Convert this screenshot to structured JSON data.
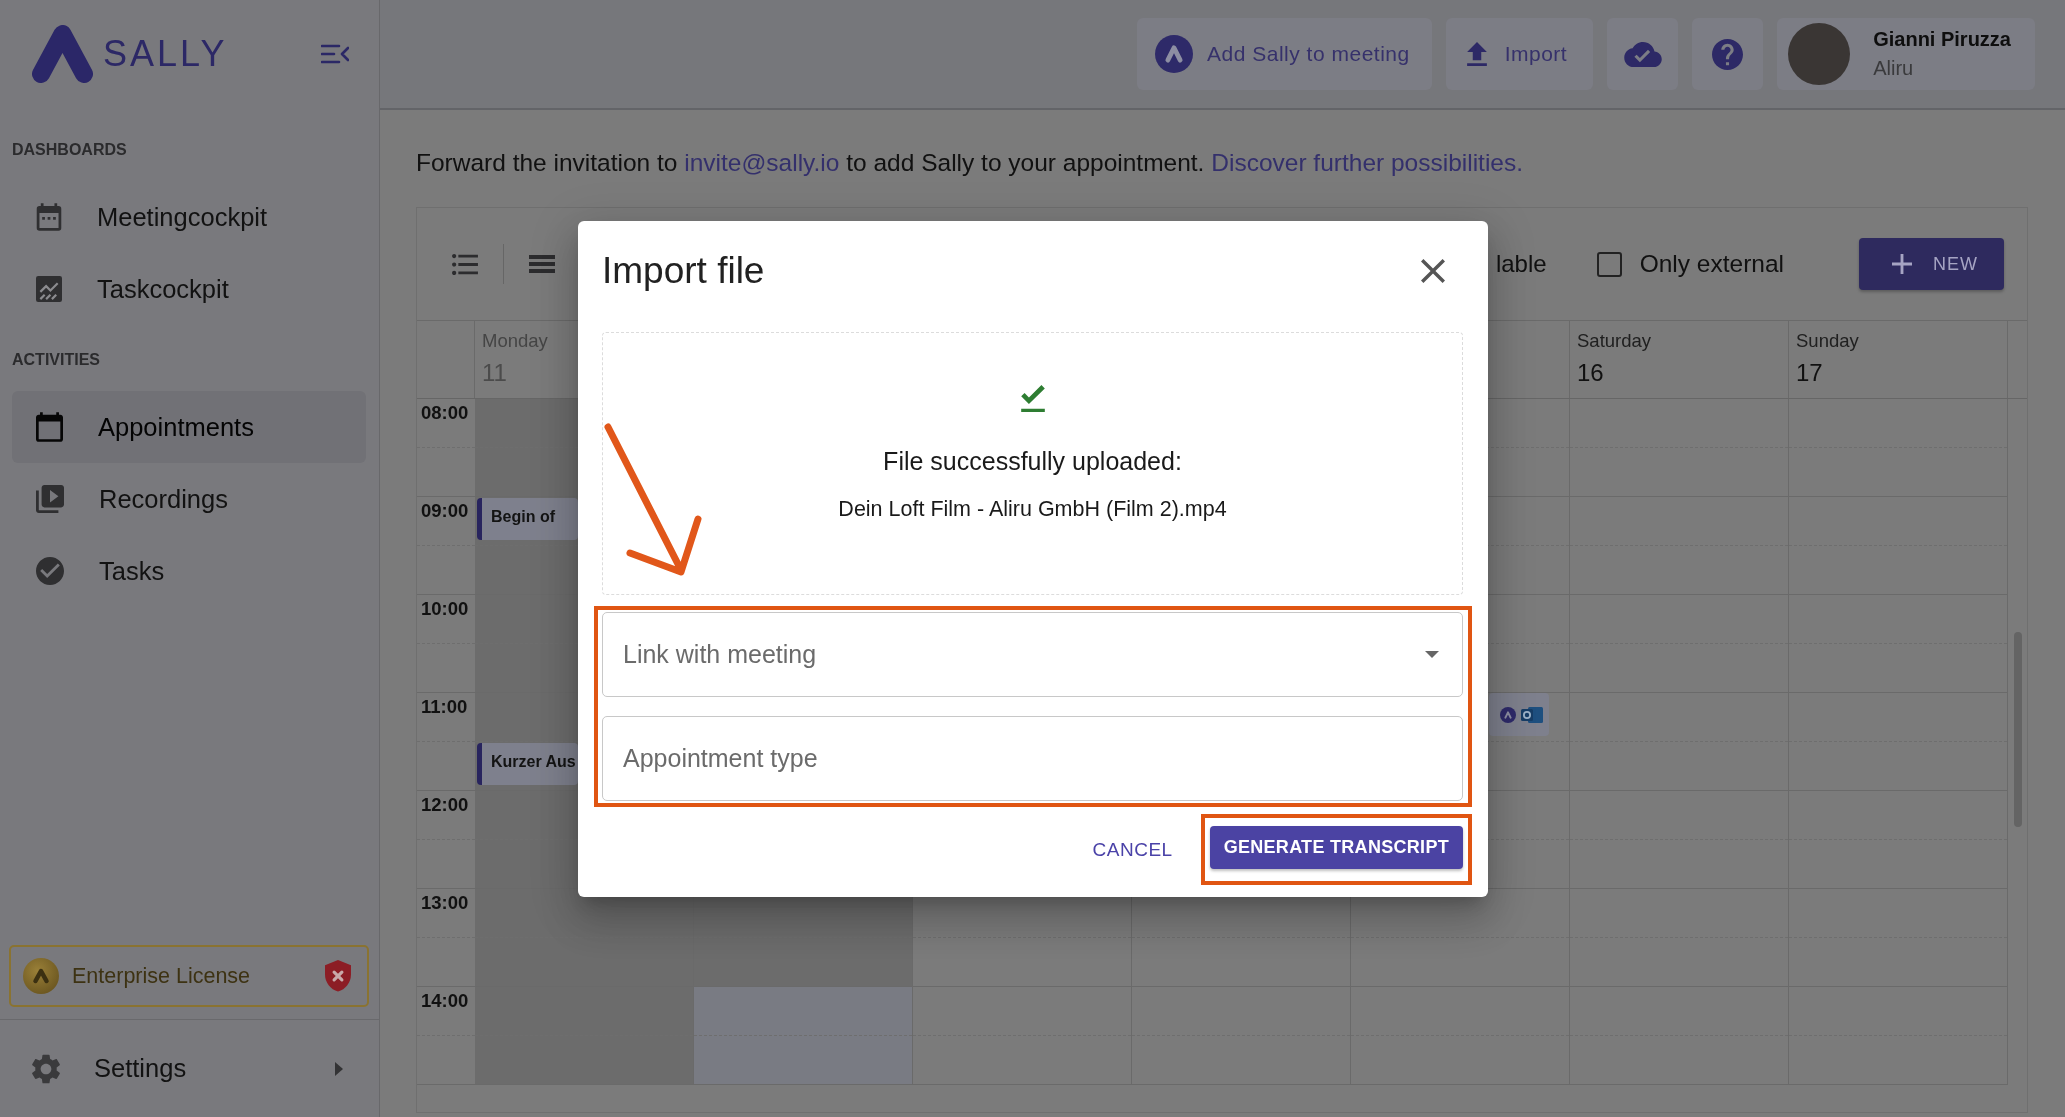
{
  "sidebar": {
    "logo": "SALLY",
    "sections": [
      {
        "heading": "DASHBOARDS",
        "items": [
          {
            "label": "Meetingcockpit",
            "selected": false
          },
          {
            "label": "Taskcockpit",
            "selected": false
          }
        ]
      },
      {
        "heading": "ACTIVITIES",
        "items": [
          {
            "label": "Appointments",
            "selected": true
          },
          {
            "label": "Recordings",
            "selected": false
          },
          {
            "label": "Tasks",
            "selected": false
          }
        ]
      }
    ],
    "license": "Enterprise License",
    "settings": "Settings"
  },
  "topbar": {
    "buttons": [
      {
        "label": "Add Sally to meeting"
      },
      {
        "label": "Import"
      }
    ],
    "user": {
      "name": "Gianni Piruzza",
      "company": "Aliru"
    }
  },
  "notice": {
    "before": "Forward the invitation to",
    "email": "invite@sally.io",
    "after": "to add Sally to your appointment.",
    "link": "Discover further possibilities."
  },
  "calendar": {
    "toolbar": {
      "filter_label": "lable",
      "only_external": {
        "label": "Only external",
        "checked": false
      },
      "new_label": "NEW"
    },
    "hours": [
      "08:00",
      "09:00",
      "10:00",
      "11:00",
      "12:00",
      "13:00",
      "14:00"
    ],
    "days": [
      {
        "name": "Monday",
        "date": "11",
        "cells": [
          {
            "kind": "past"
          },
          {
            "kind": "past",
            "events": [
              {
                "kind": "top",
                "title": "Begin of"
              }
            ]
          },
          {
            "kind": "past"
          },
          {
            "kind": "past",
            "events": [
              {
                "kind": "half",
                "title": "Kurzer Aus"
              }
            ]
          },
          {
            "kind": "past"
          },
          {
            "kind": "past"
          },
          {
            "kind": "past"
          }
        ]
      },
      {
        "cells": [
          {
            "kind": "past"
          },
          {
            "kind": "past"
          },
          {
            "kind": "past"
          },
          {
            "kind": "past"
          },
          {
            "kind": "past"
          },
          {
            "kind": "past"
          },
          {
            "kind": "now"
          }
        ]
      },
      {
        "cells": [
          {
            "kind": "free"
          },
          {
            "kind": "free"
          },
          {
            "kind": "free"
          },
          {
            "kind": "free"
          },
          {
            "kind": "free"
          },
          {
            "kind": "free"
          },
          {
            "kind": "free"
          }
        ]
      },
      {
        "cells": [
          {
            "kind": "free"
          },
          {
            "kind": "free"
          },
          {
            "kind": "free"
          },
          {
            "kind": "free"
          },
          {
            "kind": "free"
          },
          {
            "kind": "free"
          },
          {
            "kind": "free"
          }
        ]
      },
      {
        "cells": [
          {
            "kind": "free"
          },
          {
            "kind": "free"
          },
          {
            "kind": "free"
          },
          {
            "kind": "free",
            "events": [
              {
                "kind": "linked"
              }
            ]
          },
          {
            "kind": "free"
          },
          {
            "kind": "free"
          },
          {
            "kind": "free"
          }
        ]
      },
      {
        "name": "Saturday",
        "date": "16",
        "cells": [
          {
            "kind": "free"
          },
          {
            "kind": "free"
          },
          {
            "kind": "free"
          },
          {
            "kind": "free"
          },
          {
            "kind": "free"
          },
          {
            "kind": "free"
          },
          {
            "kind": "free"
          }
        ]
      },
      {
        "name": "Sunday",
        "date": "17",
        "cells": [
          {
            "kind": "free"
          },
          {
            "kind": "free"
          },
          {
            "kind": "free"
          },
          {
            "kind": "free"
          },
          {
            "kind": "free"
          },
          {
            "kind": "free"
          },
          {
            "kind": "free"
          }
        ]
      }
    ]
  },
  "dialog": {
    "title": "Import file",
    "upload": {
      "status": "File successfully uploaded:",
      "file": "Dein Loft Film - Aliru GmbH (Film 2).mp4"
    },
    "arrow": true,
    "fields_highlighted": true,
    "fields": [
      {
        "kind": "select",
        "placeholder": "Link with meeting"
      },
      {
        "kind": "text",
        "placeholder": "Appointment type"
      }
    ],
    "buttons": [
      {
        "kind": "text",
        "label": "CANCEL",
        "highlighted": false
      },
      {
        "kind": "primary",
        "label": "GENERATE TRANSCRIPT",
        "highlighted": true
      }
    ]
  }
}
